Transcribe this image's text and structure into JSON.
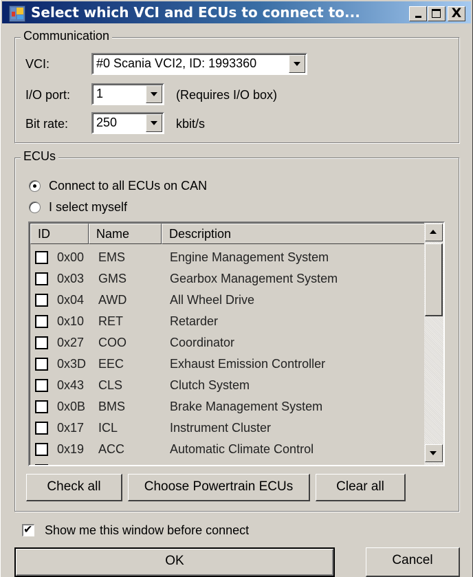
{
  "window": {
    "title": "Select which VCI and ECUs to connect to...",
    "controls": {
      "minimize": "_",
      "maximize": "□",
      "close": "X"
    }
  },
  "communication": {
    "legend": "Communication",
    "vci_label": "VCI:",
    "vci_value": "#0 Scania VCI2, ID: 1993360",
    "io_port_label": "I/O port:",
    "io_port_value": "1",
    "io_port_note": "(Requires I/O box)",
    "bit_rate_label": "Bit rate:",
    "bit_rate_value": "250",
    "bit_rate_unit": "kbit/s"
  },
  "ecus": {
    "legend": "ECUs",
    "radio_all": {
      "label": "Connect to all ECUs on CAN",
      "selected": true
    },
    "radio_self": {
      "label": "I select myself",
      "selected": false
    },
    "columns": [
      "ID",
      "Name",
      "Description"
    ],
    "rows": [
      {
        "id": "0x00",
        "name": "EMS",
        "description": "Engine Management System",
        "checked": false
      },
      {
        "id": "0x03",
        "name": "GMS",
        "description": "Gearbox Management System",
        "checked": false
      },
      {
        "id": "0x04",
        "name": "AWD",
        "description": "All Wheel Drive",
        "checked": false
      },
      {
        "id": "0x10",
        "name": "RET",
        "description": "Retarder",
        "checked": false
      },
      {
        "id": "0x27",
        "name": "COO",
        "description": "Coordinator",
        "checked": false
      },
      {
        "id": "0x3D",
        "name": "EEC",
        "description": "Exhaust Emission Controller",
        "checked": false
      },
      {
        "id": "0x43",
        "name": "CLS",
        "description": "Clutch System",
        "checked": false
      },
      {
        "id": "0x0B",
        "name": "BMS",
        "description": "Brake Management System",
        "checked": false
      },
      {
        "id": "0x17",
        "name": "ICL",
        "description": "Instrument Cluster",
        "checked": false
      },
      {
        "id": "0x19",
        "name": "ACC",
        "description": "Automatic Climate Control",
        "checked": false
      }
    ],
    "buttons": {
      "check_all": "Check all",
      "powertrain": "Choose Powertrain ECUs",
      "clear_all": "Clear all"
    }
  },
  "show_window_checkbox": {
    "label": "Show me this window before connect",
    "checked": true,
    "mark": "✔"
  },
  "footer": {
    "ok": "OK",
    "cancel": "Cancel"
  }
}
